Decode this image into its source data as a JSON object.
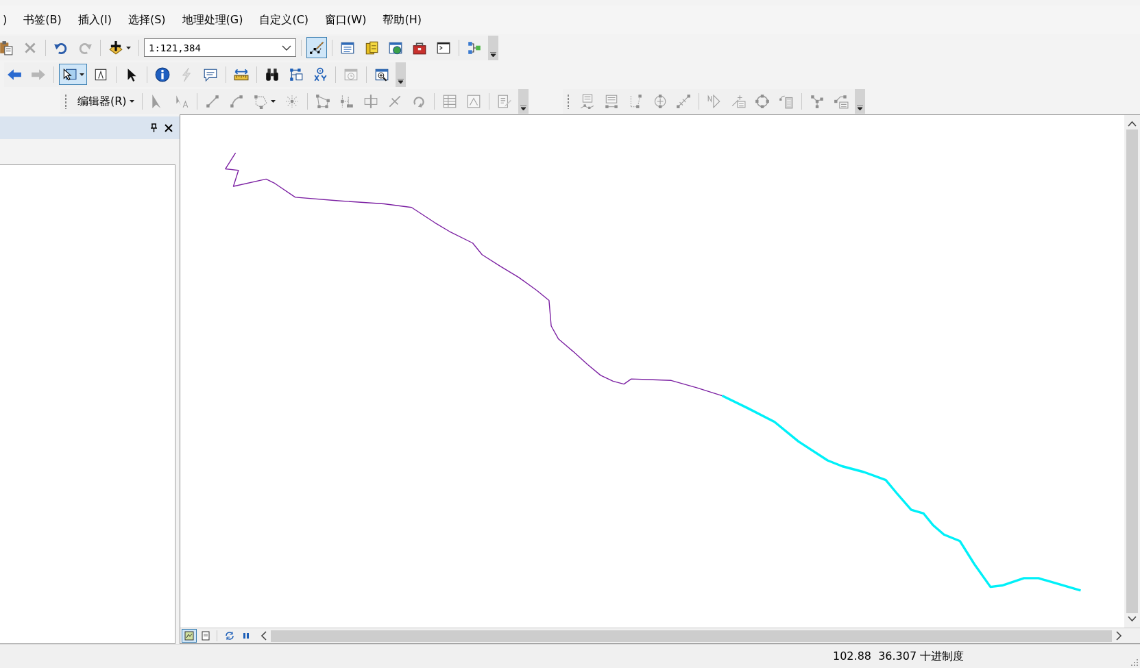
{
  "menu": [
    {
      "label": ")"
    },
    {
      "label": "书签(B)"
    },
    {
      "label": "插入(I)"
    },
    {
      "label": "选择(S)"
    },
    {
      "label": "地理处理(G)"
    },
    {
      "label": "自定义(C)"
    },
    {
      "label": "窗口(W)"
    },
    {
      "label": "帮助(H)"
    }
  ],
  "toolbar_rows": [
    {
      "toolbars": [
        {
          "items": [
            {
              "kind": "paste",
              "disabled": false,
              "selected": false
            },
            {
              "kind": "delete",
              "disabled": true,
              "selected": false
            },
            {
              "kind": "separator"
            },
            {
              "kind": "undo",
              "disabled": false,
              "selected": false
            },
            {
              "kind": "redo",
              "disabled": true,
              "selected": false
            },
            {
              "kind": "separator"
            },
            {
              "kind": "add_data",
              "disabled": false,
              "selected": false,
              "dropdown": true
            },
            {
              "kind": "separator"
            },
            {
              "kind": "scale",
              "value": "1:121,384"
            },
            {
              "kind": "separator"
            },
            {
              "kind": "editor_toolbar",
              "disabled": false,
              "selected": true
            },
            {
              "kind": "separator"
            },
            {
              "kind": "table_of_contents",
              "disabled": false,
              "selected": false
            },
            {
              "kind": "catalog",
              "disabled": false,
              "selected": false
            },
            {
              "kind": "search_window",
              "disabled": false,
              "selected": false
            },
            {
              "kind": "arctoolbox",
              "disabled": false,
              "selected": false
            },
            {
              "kind": "python",
              "disabled": false,
              "selected": false
            },
            {
              "kind": "separator"
            },
            {
              "kind": "model_builder",
              "disabled": false,
              "selected": false
            },
            {
              "kind": "overflow"
            }
          ]
        }
      ]
    },
    {
      "toolbars": [
        {
          "items": [
            {
              "kind": "back",
              "disabled": false,
              "selected": false
            },
            {
              "kind": "forward",
              "disabled": true,
              "selected": false
            },
            {
              "kind": "separator"
            },
            {
              "kind": "select_features",
              "disabled": false,
              "selected": true,
              "dropdown": true
            },
            {
              "kind": "clear_selected",
              "disabled": false,
              "selected": false
            },
            {
              "kind": "separator"
            },
            {
              "kind": "select_elements",
              "disabled": false,
              "selected": false
            },
            {
              "kind": "separator"
            },
            {
              "kind": "identify",
              "disabled": false,
              "selected": false
            },
            {
              "kind": "hyperlink",
              "disabled": true,
              "selected": false
            },
            {
              "kind": "html_popup",
              "disabled": false,
              "selected": false
            },
            {
              "kind": "separator"
            },
            {
              "kind": "measure",
              "disabled": false,
              "selected": false
            },
            {
              "kind": "separator"
            },
            {
              "kind": "find",
              "disabled": false,
              "selected": false
            },
            {
              "kind": "find_route",
              "disabled": false,
              "selected": false
            },
            {
              "kind": "go_to_xy",
              "disabled": false,
              "selected": false
            },
            {
              "kind": "separator"
            },
            {
              "kind": "time_slider",
              "disabled": true,
              "selected": false
            },
            {
              "kind": "separator"
            },
            {
              "kind": "viewer",
              "disabled": false,
              "selected": false
            },
            {
              "kind": "overflow"
            }
          ]
        }
      ]
    },
    {
      "toolbars": [
        {
          "items": [
            {
              "kind": "grip"
            },
            {
              "kind": "editor_menu",
              "label": "编辑器(R)"
            },
            {
              "kind": "separator"
            },
            {
              "kind": "edit_tool",
              "disabled": true,
              "selected": false
            },
            {
              "kind": "edit_annotation",
              "disabled": true,
              "selected": false
            },
            {
              "kind": "separator"
            },
            {
              "kind": "straight_segment",
              "disabled": true,
              "selected": false
            },
            {
              "kind": "endpoint_arc",
              "disabled": true,
              "selected": false
            },
            {
              "kind": "trace",
              "disabled": true,
              "selected": false,
              "dropdown": true
            },
            {
              "kind": "point",
              "disabled": true,
              "selected": false
            },
            {
              "kind": "separator"
            },
            {
              "kind": "edit_vertices",
              "disabled": true,
              "selected": false
            },
            {
              "kind": "reshape",
              "disabled": true,
              "selected": false
            },
            {
              "kind": "cut_polygons",
              "disabled": true,
              "selected": false
            },
            {
              "kind": "split",
              "disabled": true,
              "selected": false
            },
            {
              "kind": "rotate",
              "disabled": true,
              "selected": false
            },
            {
              "kind": "separator"
            },
            {
              "kind": "attributes",
              "disabled": true,
              "selected": false
            },
            {
              "kind": "sketch_properties",
              "disabled": true,
              "selected": false
            },
            {
              "kind": "separator"
            },
            {
              "kind": "create_features",
              "disabled": true,
              "selected": false
            },
            {
              "kind": "overflow"
            }
          ]
        },
        {
          "items": [
            {
              "kind": "grip"
            },
            {
              "kind": "vertex_list",
              "disabled": true,
              "selected": false
            },
            {
              "kind": "segment_list",
              "disabled": true,
              "selected": false
            },
            {
              "kind": "square_line",
              "disabled": true,
              "selected": false
            },
            {
              "kind": "circle_vertex",
              "disabled": true,
              "selected": false
            },
            {
              "kind": "dashed_line",
              "disabled": true,
              "selected": false
            },
            {
              "kind": "separator"
            },
            {
              "kind": "north_direction",
              "disabled": true,
              "selected": false
            },
            {
              "kind": "add_table",
              "disabled": true,
              "selected": false
            },
            {
              "kind": "circle_polygon",
              "disabled": true,
              "selected": false
            },
            {
              "kind": "calculator",
              "disabled": true,
              "selected": false
            },
            {
              "kind": "separator"
            },
            {
              "kind": "flow_split",
              "disabled": true,
              "selected": false
            },
            {
              "kind": "flow_table",
              "disabled": true,
              "selected": false
            },
            {
              "kind": "overflow"
            }
          ]
        }
      ]
    }
  ],
  "view_buttons": [
    {
      "kind": "data_view",
      "selected": true
    },
    {
      "kind": "layout_view",
      "selected": false
    }
  ],
  "map_controls": [
    {
      "kind": "refresh"
    },
    {
      "kind": "pause"
    }
  ],
  "map": {
    "features": [
      {
        "kind": "line",
        "color": "#7b1fa2"
      },
      {
        "kind": "line",
        "color": "#00f0f8"
      }
    ]
  },
  "status_bar": {
    "coordinates": "102.88  36.307 十进制度"
  }
}
